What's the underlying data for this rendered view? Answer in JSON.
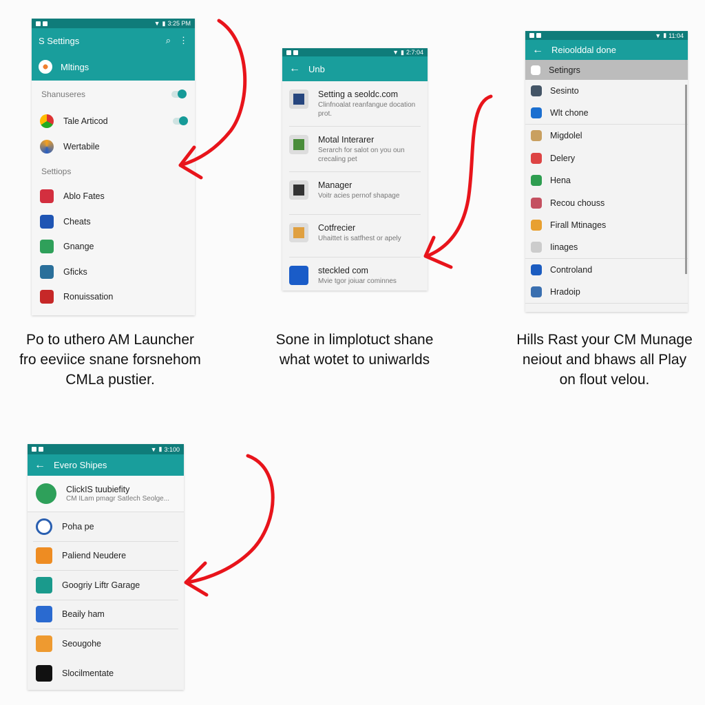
{
  "colors": {
    "status_bar": "#0f7c7a",
    "app_bar": "#199e9c",
    "arrow": "#e8141b"
  },
  "panel1": {
    "status_time": "3:25 PM",
    "title": "S Settings",
    "account": "Mltings",
    "section1": "Shanuseres",
    "items1": [
      {
        "label": "Tale Articod",
        "icon": "chrome-icon",
        "toggle": true
      },
      {
        "label": "Wertabile",
        "icon": "firefox-icon"
      }
    ],
    "section2": "Settiops",
    "items2": [
      {
        "label": "Ablo Fates",
        "icon": "gmail-icon",
        "color": "#d32f3f"
      },
      {
        "label": "Cheats",
        "icon": "document-icon",
        "color": "#1f55b4"
      },
      {
        "label": "Gnange",
        "icon": "chat-icon",
        "color": "#2fa05a"
      },
      {
        "label": "Gficks",
        "icon": "folder-icon",
        "color": "#2a6f9a"
      },
      {
        "label": "Ronuissation",
        "icon": "card-icon",
        "color": "#c62828"
      }
    ]
  },
  "panel2": {
    "status_time": "2:7:04",
    "title": "Unb",
    "items": [
      {
        "title": "Setting a seoldc.com",
        "sub": "Clinfnoalat reanfangue docation prot.",
        "icon": "document-icon",
        "color": "#27467e"
      },
      {
        "title": "Motal Interarer",
        "sub": "Serarch for salot on you oun crecaling pet",
        "icon": "chrome-icon",
        "color": "#4a8d3a"
      },
      {
        "title": "Manager",
        "sub": "Voitr acies pernof shapage",
        "icon": "briefcase-icon",
        "color": "#333"
      },
      {
        "title": "Cotfrecier",
        "sub": "Uhaittet is satfhest or apely",
        "icon": "drawer-icon",
        "color": "#e0a040"
      },
      {
        "title": "steckled com",
        "sub": "Mvie tgor joiuar cominnes",
        "icon": "mail-icon",
        "color": "#1a5cc8"
      }
    ]
  },
  "panel3": {
    "status_time": "11:04",
    "title": "Reioolddal done",
    "selected": "Setingrs",
    "items": [
      {
        "label": "Sesinto",
        "icon": "calendar-icon",
        "color": "#456"
      },
      {
        "label": "Wlt chone",
        "icon": "mail-icon",
        "color": "#1b6fd0",
        "divider": true
      },
      {
        "label": "Migdolel",
        "icon": "gallery-icon",
        "color": "#c9a060"
      },
      {
        "label": "Delery",
        "icon": "chrome-icon",
        "color": "#d44"
      },
      {
        "label": "Hena",
        "icon": "maps-icon",
        "color": "#2e9d50"
      },
      {
        "label": "Recou chouss",
        "icon": "record-icon",
        "color": "#c45060"
      },
      {
        "label": "Firall Mtinages",
        "icon": "firefox-icon",
        "color": "#e8a030"
      },
      {
        "label": "Iinages",
        "icon": "folder-icon",
        "color": "#ccc",
        "divider": true
      },
      {
        "label": "Controland",
        "icon": "monitor-icon",
        "color": "#1b5cc0"
      },
      {
        "label": "Hradoip",
        "icon": "tree-icon",
        "color": "#3a6fb0",
        "divider": true
      }
    ]
  },
  "panel4": {
    "status_time": "3:100",
    "title": "Evero Shipes",
    "top": {
      "title": "ClickIS tuubiefity",
      "sub": "CM ILam pmagr Satlech Seolge..."
    },
    "items": [
      {
        "label": "Poha pe",
        "icon": "clock-icon",
        "color": "#2a5fb0",
        "round": true,
        "divider": true
      },
      {
        "label": "Paliend Neudere",
        "icon": "puzzle-icon",
        "color": "#ee8c22",
        "divider": true
      },
      {
        "label": "Googriy Liftr Garage",
        "icon": "garage-icon",
        "color": "#1a9a8c",
        "divider": true
      },
      {
        "label": "Beaily ham",
        "icon": "cloud-icon",
        "color": "#2a6ad0",
        "divider": true
      },
      {
        "label": "Seougohe",
        "icon": "circle-icon",
        "color": "#ee9a30"
      },
      {
        "label": "Slocilmentate",
        "icon": "box-icon",
        "color": "#111"
      }
    ]
  },
  "captions": [
    [
      "Po to uthero AM Launcher",
      "fro eeviice snane forsnehom",
      "CMLa pustier."
    ],
    [
      "Sone in limplotuct shane",
      "what wotet to uniwarlds"
    ],
    [
      "Hills Rast your CM Munage",
      "neiout and bhaws all Play",
      "on flout velou."
    ]
  ]
}
